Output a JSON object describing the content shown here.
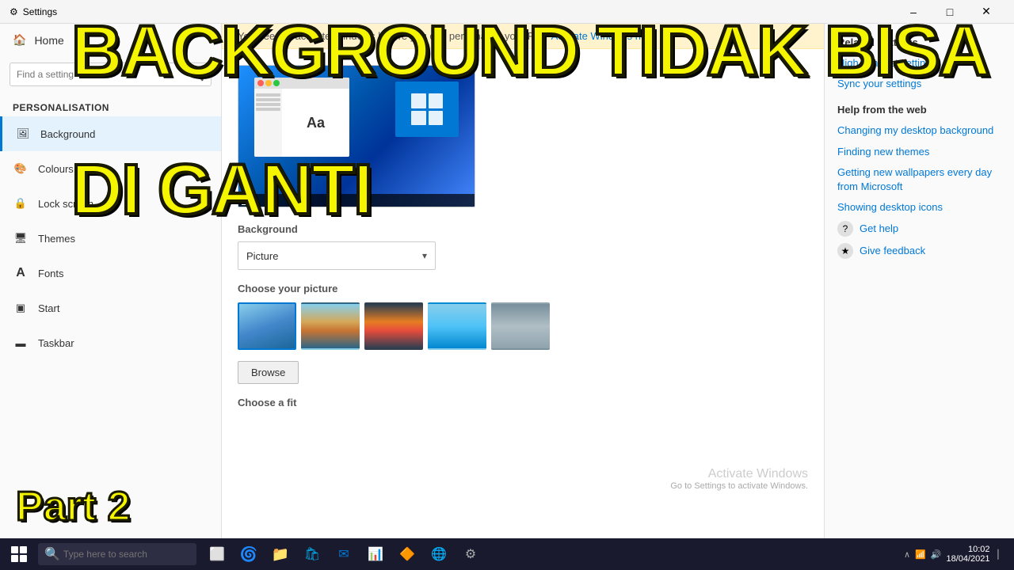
{
  "window": {
    "title": "Settings",
    "title_icon": "⚙"
  },
  "sidebar": {
    "home_label": "Home",
    "search_placeholder": "Find a setting",
    "section_title": "Personalisation",
    "items": [
      {
        "id": "background",
        "label": "Background",
        "icon": "🖼"
      },
      {
        "id": "colours",
        "label": "Colours",
        "icon": "🎨"
      },
      {
        "id": "lock-screen",
        "label": "Lock screen",
        "icon": "🔒"
      },
      {
        "id": "themes",
        "label": "Themes",
        "icon": "🖥"
      },
      {
        "id": "fonts",
        "label": "Fonts",
        "icon": "A"
      },
      {
        "id": "start",
        "label": "Start",
        "icon": "▣"
      },
      {
        "id": "taskbar",
        "label": "Taskbar",
        "icon": "▬"
      }
    ]
  },
  "activate_banner": {
    "text": "You need to activate Windows before you can personalise your PC.",
    "link_text": "Activate Windows now."
  },
  "main": {
    "background_section_label": "Background",
    "dropdown_value": "Picture",
    "choose_picture_label": "Choose your picture",
    "browse_label": "Browse",
    "choose_fit_label": "Choose a fit"
  },
  "right_panel": {
    "related_title": "Related Settings",
    "related_links": [
      {
        "id": "high-contrast",
        "text": "High contrast settings"
      },
      {
        "id": "sync-settings",
        "text": "Sync your settings"
      }
    ],
    "help_title": "Help from the web",
    "help_links": [
      {
        "id": "changing-bg",
        "text": "Changing my desktop background"
      },
      {
        "id": "finding-themes",
        "text": "Finding new themes"
      },
      {
        "id": "getting-wallpapers",
        "text": "Getting new wallpapers every day from Microsoft"
      },
      {
        "id": "showing-icons",
        "text": "Showing desktop icons"
      }
    ],
    "get_help_label": "Get help",
    "give_feedback_label": "Give feedback"
  },
  "activate_watermark": {
    "title": "Activate Windows",
    "subtitle": "Go to Settings to activate Windows."
  },
  "overlay": {
    "line1": "BACKGROUND TIDAK BISA",
    "line2": "DI GANTI",
    "part_label": "Part 2"
  },
  "taskbar": {
    "search_placeholder": "Type here to search",
    "time": "10:02",
    "date": "18/04/2021"
  }
}
